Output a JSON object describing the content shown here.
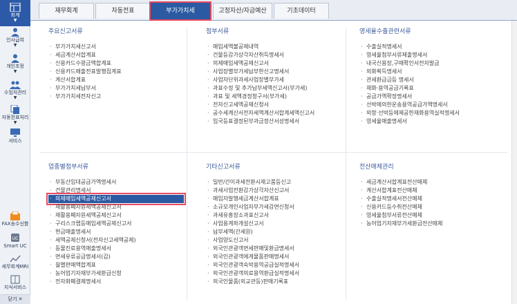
{
  "sidebar": {
    "items": [
      {
        "label": "회계",
        "icon": "ledger-icon",
        "active": true
      },
      {
        "label": "인사급여",
        "icon": "person-icon"
      },
      {
        "label": "개인조정",
        "icon": "person-icon"
      },
      {
        "label": "수임처관리",
        "icon": "people-icon"
      },
      {
        "label": "자동전표처리",
        "icon": "documents-icon"
      },
      {
        "label": "서비스",
        "icon": "monitor-icon"
      },
      {
        "label": "FAX송수신함",
        "icon": "fax-icon"
      },
      {
        "label": "Smart UC",
        "icon": "uc-icon"
      },
      {
        "label": "세무회계MRI",
        "icon": "chart-icon"
      },
      {
        "label": "지식서비스",
        "icon": "book-icon"
      }
    ],
    "bottom_label": "닫기 ✕"
  },
  "tabs": [
    {
      "label": "재무회계"
    },
    {
      "label": "자동전표"
    },
    {
      "label": "부가가치세",
      "active": true
    },
    {
      "label": "고정자산/자금예산"
    },
    {
      "label": "기초데이터"
    }
  ],
  "sections": {
    "main_reports": {
      "title": "주요신고서류",
      "items": [
        "부가가치세신고서",
        "세금계산서합계표",
        "신용카드수령금액합계표",
        "신용카드매출전표발행집계표",
        "계산서합계표",
        "부가가치세납부서",
        "부가가치세전자신고"
      ]
    },
    "attachments": {
      "title": "첨부서류",
      "items": [
        "매입세액불공제내역",
        "건물등감가상각자산취득명세서",
        "의제매입세액공제신고서",
        "사업장별부가세납부한신고명세서",
        "사업자단위과세사업장별부가세",
        "과표수정 및 추가납부세액신고서(부가세)",
        "과표 및 세액경정청구서(부가세)",
        "전자신고세액공제신청서",
        "공수세계산서전자세액계산서합계세액신고서",
        "입국등표결정된부과금정산서성명세서"
      ]
    },
    "zero_rate": {
      "title": "영세율수출관련서류",
      "items": [
        "수출실적명세서",
        "영세율첨부서류제출명세서",
        "내국신용장,구매확인서전자발급",
        "외화획득명세서",
        "관세환급금등 명세서",
        "재화·용역공급기록표",
        "공급가액확정명세서",
        "선박에의한운송용역공급가액명세서",
        "외항·선박등에제공한재화용역실적명세서",
        "영세율매출명세서"
      ]
    },
    "industry": {
      "title": "업종별첨부서류",
      "items": [
        "부동산임대공급가액명세서",
        "건물관리명세서",
        "의제매입세액공제신고서",
        "재활용폐자원세액공제신고서",
        "재활용폐자원세액공제신고서",
        "구리스크랩등매입세액공제신고서",
        "현금매출명세서",
        "세액공제신청서(전자신고세액공제)",
        "동물진료용역매출명세서",
        "면세유류공급명세서(갑)",
        "월별판매액합계표",
        "농어업기자재부가세환급신청",
        "전자화폐결제명세서"
      ]
    },
    "other_reports": {
      "title": "기타신고서류",
      "items": [
        "일반/간이과세전환시재고품등신고",
        "과세사업전환감가상각자산신고서",
        "매입자발행세금계산서합계표",
        "소규모개인사업자부가세감면신청서",
        "과세유흥장소과표신고서",
        "사업용계좌개설신고서",
        "납부세액(간세원)",
        "사업양도신고서",
        "외국인관광객면세판매및환급명세서",
        "외국인관광객에게물품판매명세서",
        "외국인관광객숙박용역공급실적명세서",
        "외국인관광객의료용역환급실적명세서",
        "외국인물품(외교관등)판매기록표"
      ]
    },
    "e_filing": {
      "title": "전산매체관리",
      "items": [
        "세금계산서합계표전산매체",
        "계산서합계표전산매체",
        "수출실적명세서전산매체",
        "신용카드등수취전산매체",
        "영세율첨부서류전산매체",
        "농어업기자재부가세환급전산매체"
      ]
    }
  }
}
